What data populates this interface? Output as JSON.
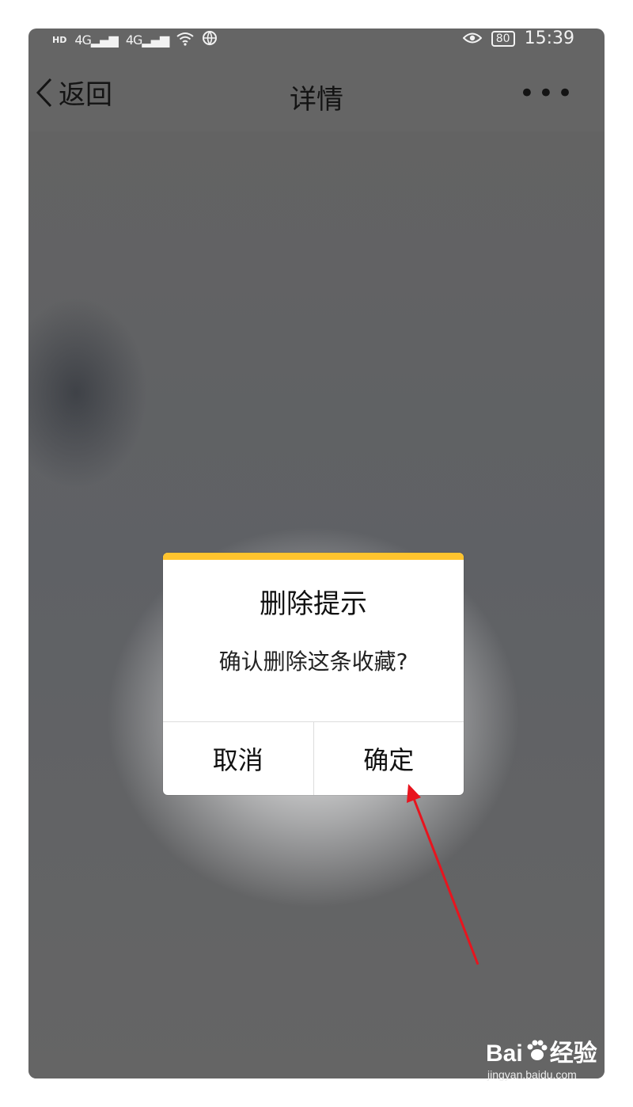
{
  "status_bar": {
    "hd_label": "HD",
    "sim1": "4G",
    "sim2": "4G",
    "battery": "80",
    "time": "15:39"
  },
  "nav": {
    "back_label": "返回",
    "title": "详情",
    "more_label": "•••"
  },
  "dialog": {
    "title": "删除提示",
    "message": "确认删除这条收藏?",
    "cancel_label": "取消",
    "confirm_label": "确定",
    "accent_color": "#ffc42e"
  },
  "annotation": {
    "arrow_color": "#e8141e",
    "points_to": "confirm-button"
  },
  "watermark": {
    "brand_left": "Bai",
    "brand_right": "经验",
    "url": "jingyan.baidu.com"
  }
}
